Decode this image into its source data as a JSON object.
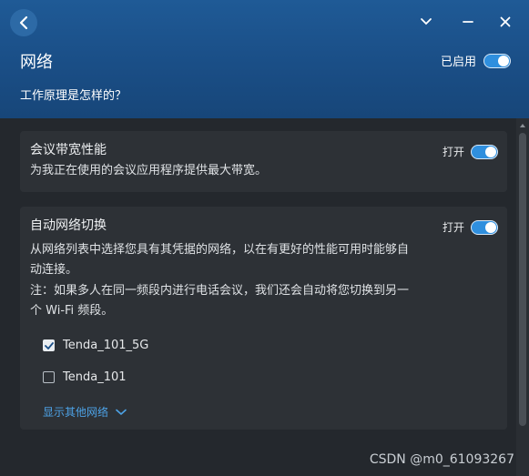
{
  "header": {
    "title": "网络",
    "enabled_label": "已启用",
    "help_link": "工作原理是怎样的？",
    "colors": {
      "background": "#1a4e86",
      "toggle_on": "#2f8fde"
    }
  },
  "window_controls": [
    "chevron-down-icon",
    "minimize-icon",
    "close-icon"
  ],
  "cards": {
    "bandwidth": {
      "title": "会议带宽性能",
      "description": "为我正在使用的会议应用程序提供最大带宽。",
      "toggle_label": "打开",
      "toggle_on": true
    },
    "auto_switch": {
      "title": "自动网络切换",
      "toggle_label": "打开",
      "toggle_on": true,
      "description_lines": [
        "从网络列表中选择您具有其凭据的网络，以在有更好的性能可用时能够自",
        "动连接。",
        "注：如果多人在同一频段内进行电话会议，我们还会自动将您切换到另一",
        "个 Wi-Fi 频段。"
      ],
      "networks": [
        {
          "name": "Tenda_101_5G",
          "checked": true
        },
        {
          "name": "Tenda_101",
          "checked": false
        }
      ],
      "show_more": "显示其他网络"
    }
  },
  "watermark": "CSDN @m0_61093267"
}
